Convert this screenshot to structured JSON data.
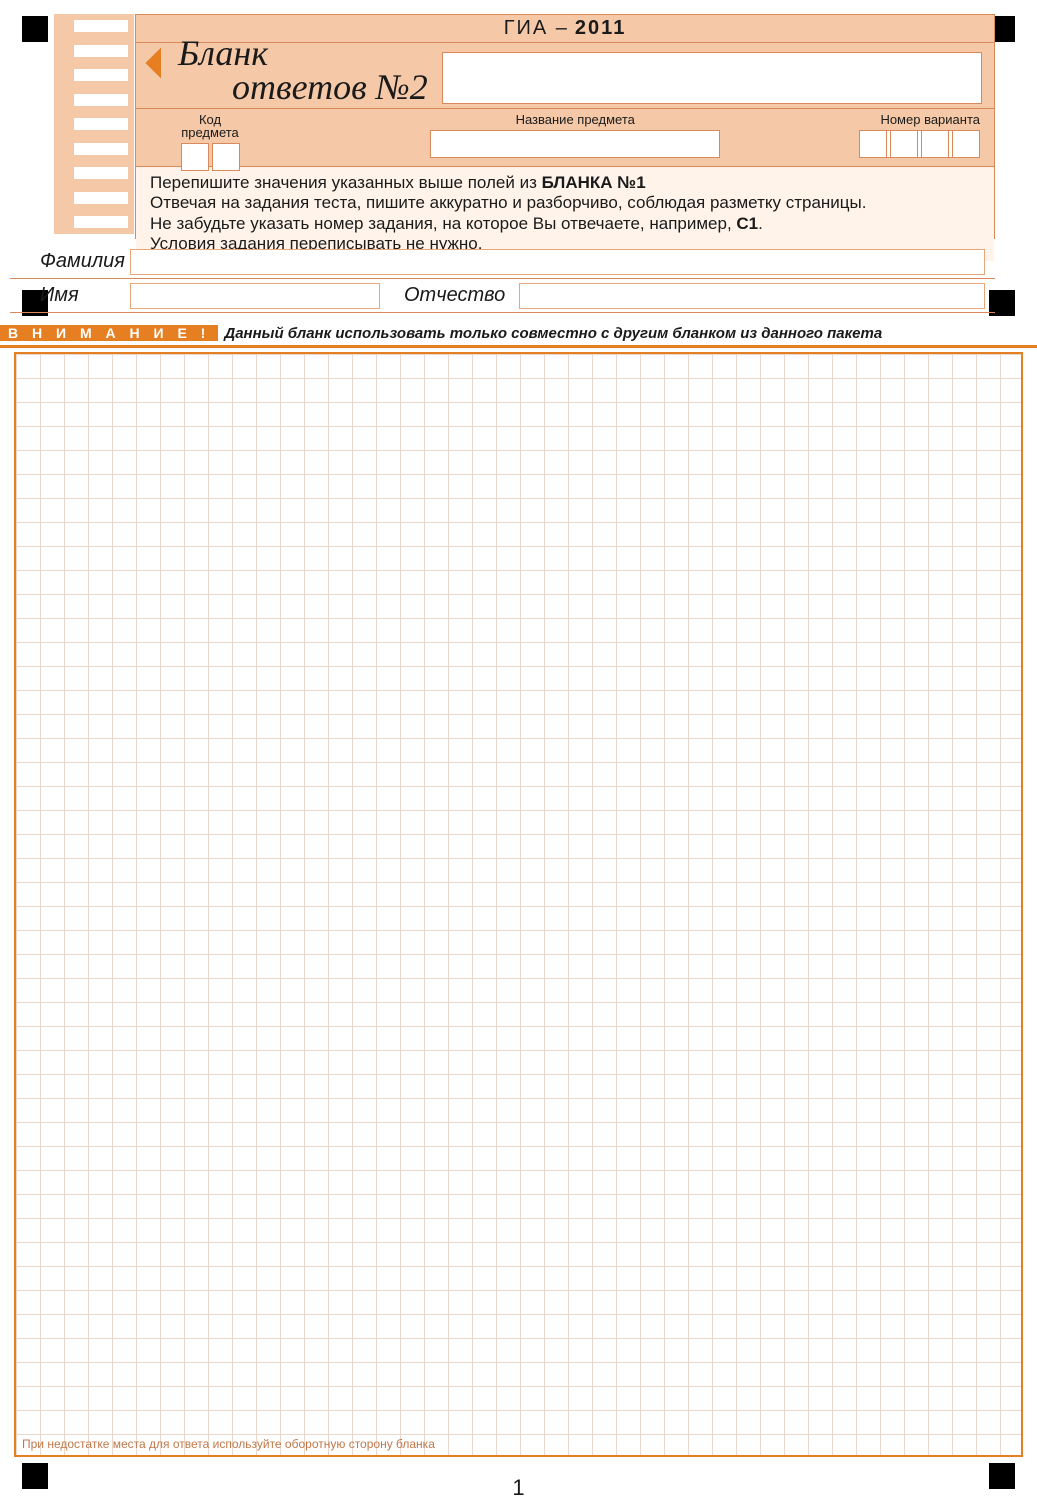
{
  "exam": {
    "name": "ГИА",
    "dash": "–",
    "year": "2011"
  },
  "title": {
    "line1": "Бланк",
    "line2": "ответов №2"
  },
  "fields": {
    "code_label": "Код\nпредмета",
    "code_count": 2,
    "subject_label": "Название предмета",
    "variant_label": "Номер варианта",
    "variant_count": 3,
    "extra_count": 4
  },
  "instructions": {
    "l1_a": "Перепишите значения указанных выше полей из ",
    "l1_b": "БЛАНКА №1",
    "l2": "Отвечая на задания теста, пишите аккуратно и разборчиво, соблюдая разметку страницы.",
    "l3_a": "Не забудьте указать номер задания, на которое Вы отвечаете, например, ",
    "l3_b": "С1",
    "l3_c": ".",
    "l4": "Условия задания переписывать не нужно."
  },
  "person": {
    "surname_label": "Фамилия",
    "name_label": "Имя",
    "patronymic_label": "Отчество"
  },
  "attention": {
    "tag": "В Н И М А Н И Е !",
    "text": "Данный бланк использовать только совместно с  другим бланком из данного пакета"
  },
  "grid_footer": "При недостатке места для ответа используйте оборотную сторону бланка",
  "page_number": "1"
}
